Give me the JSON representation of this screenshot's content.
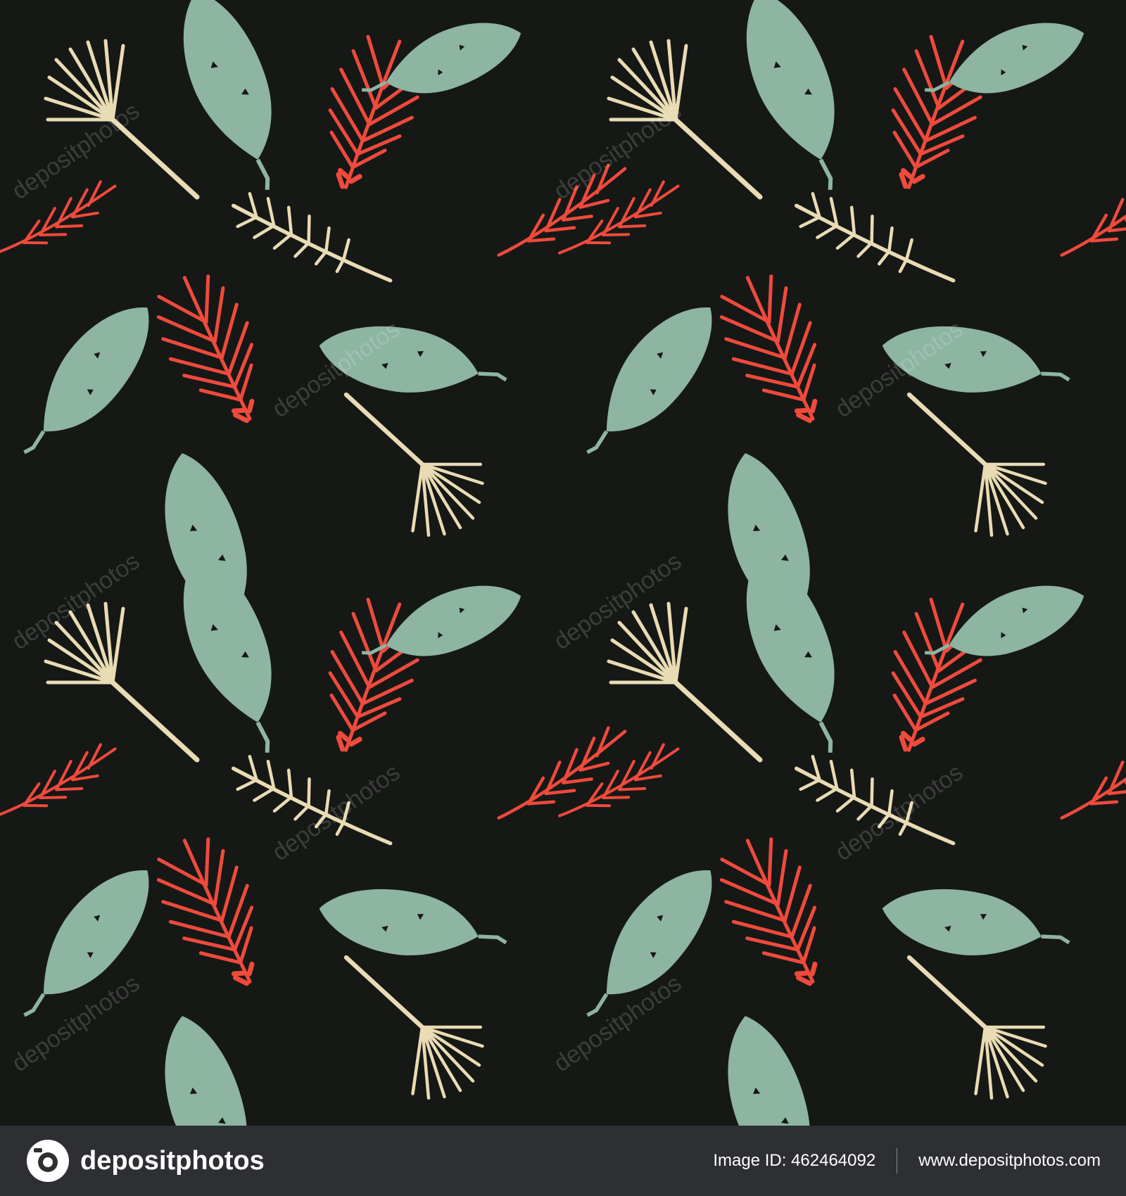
{
  "colors": {
    "background": "#161816",
    "sage": "#8db5a2",
    "coral": "#ef4a3c",
    "cream": "#e9dbb3",
    "footer": "#2d2f32"
  },
  "pattern": {
    "motifs": [
      "banana-leaf",
      "fern-frond",
      "fan-palm-leaf",
      "feather-frond"
    ]
  },
  "watermark": {
    "text": "depositphotos"
  },
  "footer": {
    "brand": "depositphotos",
    "image_id": "Image ID: 462464092",
    "site": "www.depositphotos.com"
  }
}
